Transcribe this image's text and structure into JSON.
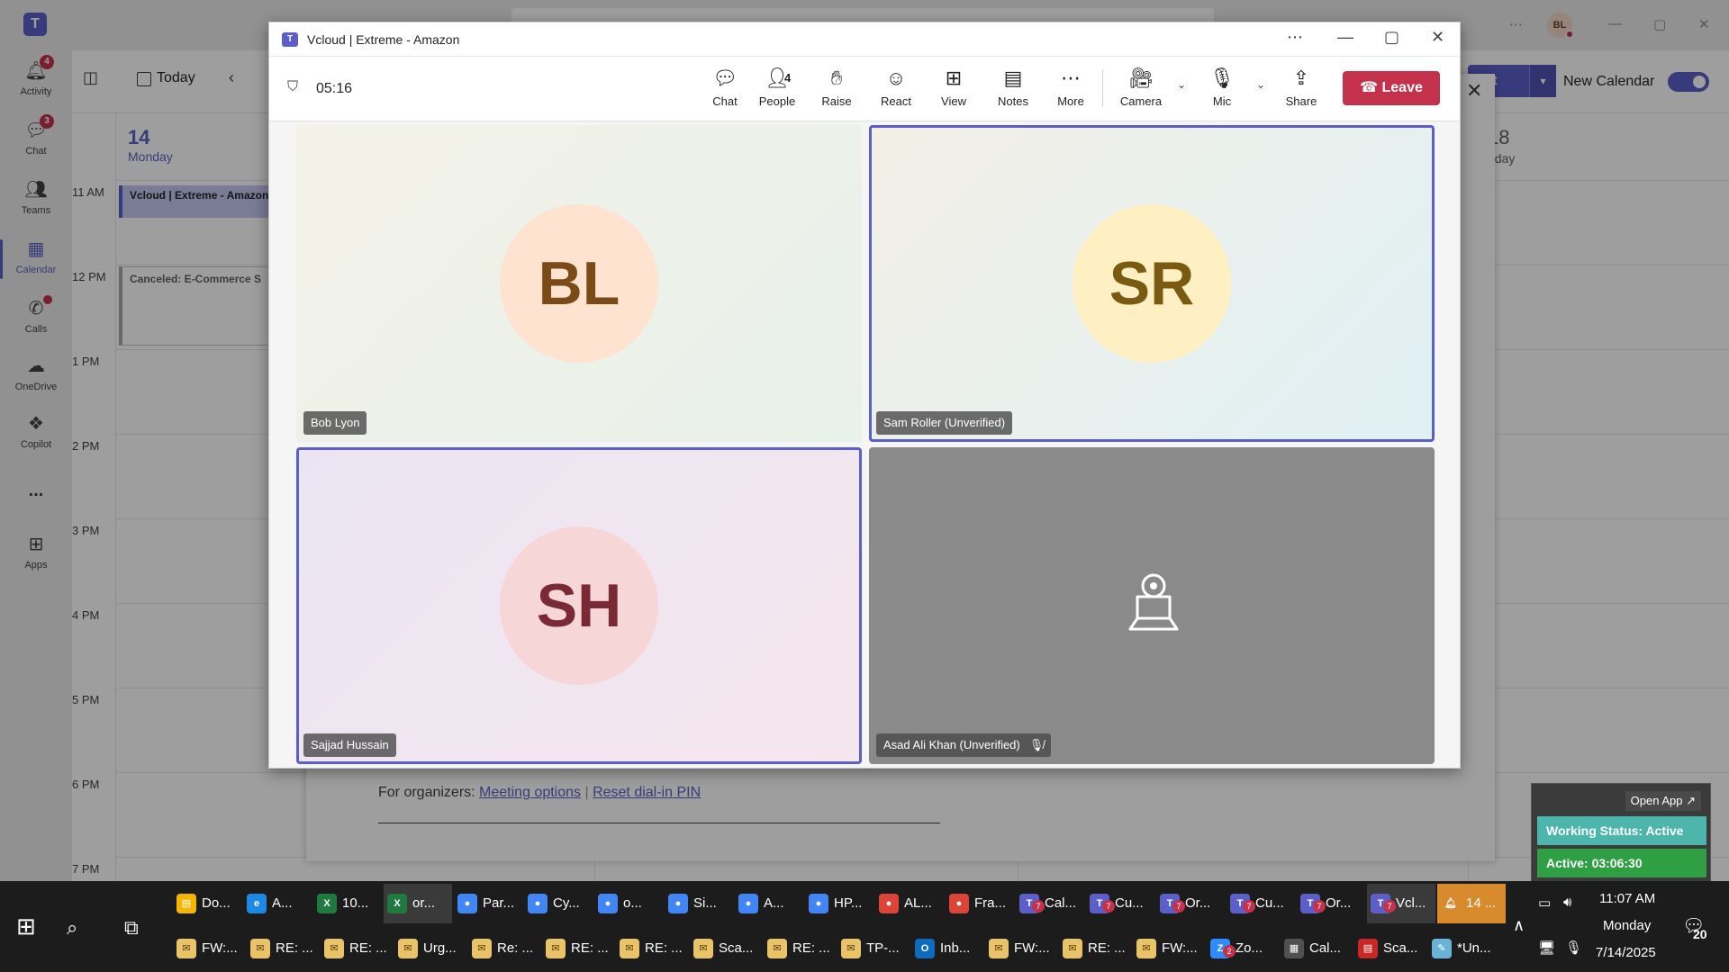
{
  "teams": {
    "user_initials": "BL",
    "rail": [
      {
        "label": "Activity",
        "badge": "4"
      },
      {
        "label": "Chat",
        "badge": "3"
      },
      {
        "label": "Teams"
      },
      {
        "label": "Calendar"
      },
      {
        "label": "Calls"
      },
      {
        "label": "OneDrive"
      },
      {
        "label": "Copilot"
      },
      {
        "label": "..."
      },
      {
        "label": "Apps"
      }
    ],
    "calendar": {
      "today_label": "Today",
      "day_num": "14",
      "day_name": "Monday",
      "day18_num": "18",
      "day18_name": "riday",
      "hours": [
        "11 AM",
        "12 PM",
        "1 PM",
        "2 PM",
        "3 PM",
        "4 PM",
        "5 PM",
        "6 PM",
        "7 PM"
      ],
      "event1": "Vcloud | Extreme - Amazon",
      "event2": "Canceled: E-Commerce S",
      "new_event_label": "ent",
      "new_calendar_label": "New Calendar"
    },
    "details": {
      "organizers_prefix": "For organizers:",
      "meeting_options": "Meeting options",
      "divider": "|",
      "reset_pin": "Reset dial-in PIN"
    }
  },
  "meeting": {
    "window_title": "Vcloud | Extreme - Amazon",
    "timer": "05:16",
    "toolbar": {
      "chat": "Chat",
      "people": "People",
      "people_count": "4",
      "raise": "Raise",
      "react": "React",
      "view": "View",
      "notes": "Notes",
      "more": "More",
      "camera": "Camera",
      "mic": "Mic",
      "share": "Share",
      "leave": "Leave"
    },
    "participants": [
      {
        "initials": "BL",
        "name": "Bob Lyon"
      },
      {
        "initials": "SR",
        "name": "Sam Roller (Unverified)"
      },
      {
        "initials": "SH",
        "name": "Sajjad Hussain"
      },
      {
        "initials": "",
        "name": "Asad Ali Khan (Unverified)"
      }
    ]
  },
  "widget": {
    "open_app": "Open App ↗",
    "working_status": "Working Status: Active",
    "active_time": "Active: 03:06:30"
  },
  "taskbar": {
    "row1": [
      "Do...",
      "A...",
      "10...",
      "or...",
      "Par...",
      "Cy...",
      "o...",
      "Si...",
      "A...",
      "HP...",
      "AL...",
      "Fra...",
      "Cal...",
      "Cu...",
      "Or...",
      "Cu...",
      "Or...",
      "Vcl...",
      "14 ..."
    ],
    "row2": [
      "FW:...",
      "RE: ...",
      "RE: ...",
      "Urg...",
      "Re: ...",
      "RE: ...",
      "RE: ...",
      "Sca...",
      "RE: ...",
      "TP-...",
      "Inb...",
      "FW:...",
      "RE: ...",
      "FW:...",
      "Zo...",
      "Cal...",
      "Sca...",
      "*Un..."
    ],
    "badge_count": "7",
    "zoom_badge": "2",
    "time": "11:07 AM",
    "day": "Monday",
    "date": "7/14/2025",
    "notifications": "20"
  },
  "colors": {
    "accent": "#5b5fc7",
    "leave": "#c4314b"
  }
}
